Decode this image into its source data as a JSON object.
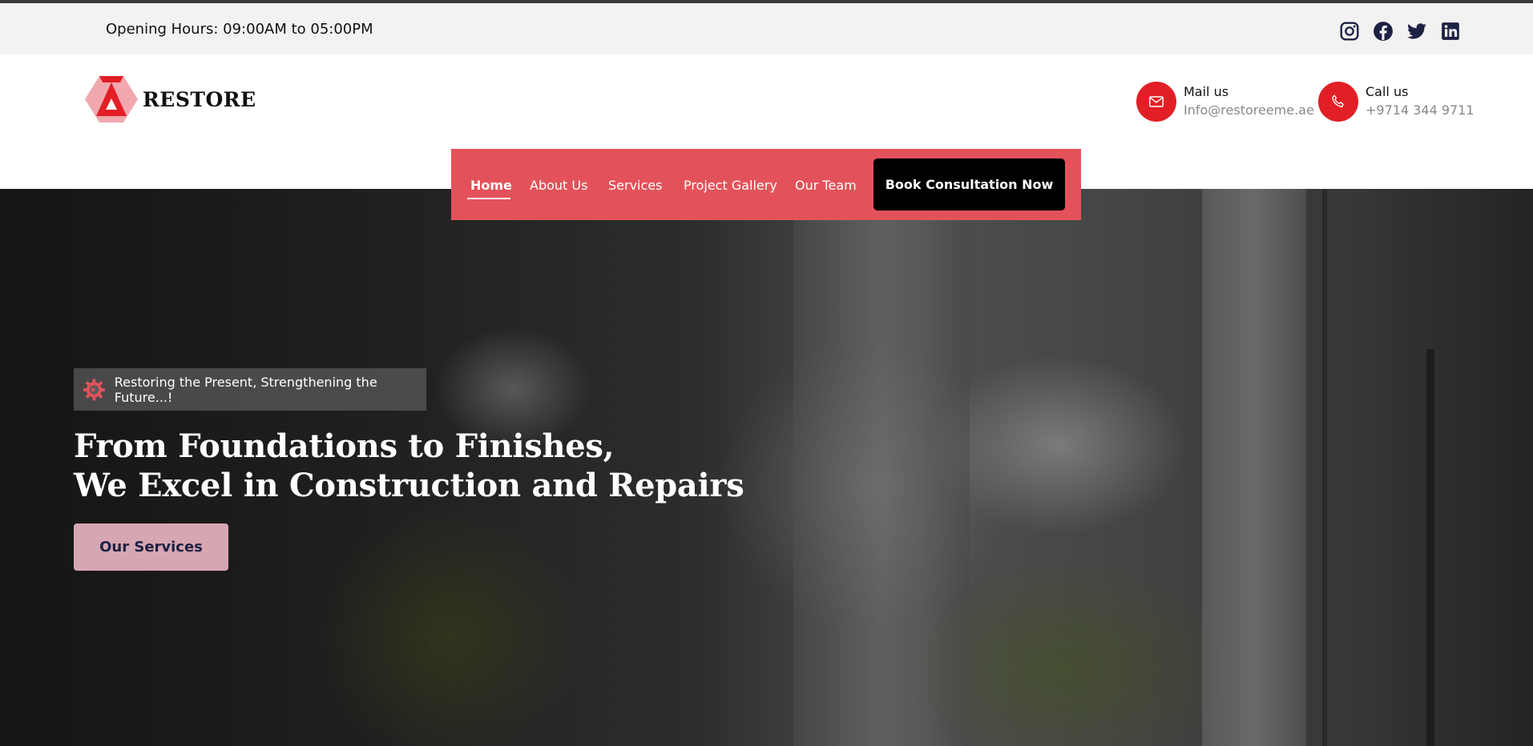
{
  "topbar": {
    "opening_hours": "Opening Hours: 09:00AM to 05:00PM",
    "social": [
      "instagram-icon",
      "facebook-icon",
      "twitter-icon",
      "linkedin-icon"
    ]
  },
  "brand": {
    "name": "RESTORE",
    "colors": {
      "accent": "#e21f26",
      "nav_bg": "#e3525a"
    }
  },
  "contacts": {
    "mail": {
      "label": "Mail us",
      "value": "Info@restoreeme.ae",
      "icon": "envelope-icon"
    },
    "call": {
      "label": "Call us",
      "value": "+9714 344 9711",
      "icon": "phone-icon"
    }
  },
  "nav": {
    "items": [
      {
        "label": "Home",
        "active": true
      },
      {
        "label": "About Us"
      },
      {
        "label": "Services"
      },
      {
        "label": "Project Gallery"
      },
      {
        "label": "Our Team"
      }
    ],
    "cta": "Book Consultation Now"
  },
  "hero": {
    "tagline": "Restoring the Present, Strengthening the Future...!",
    "headline_line1": "From Foundations to Finishes,",
    "headline_line2": "We Excel in Construction and Repairs",
    "button": "Our Services"
  }
}
